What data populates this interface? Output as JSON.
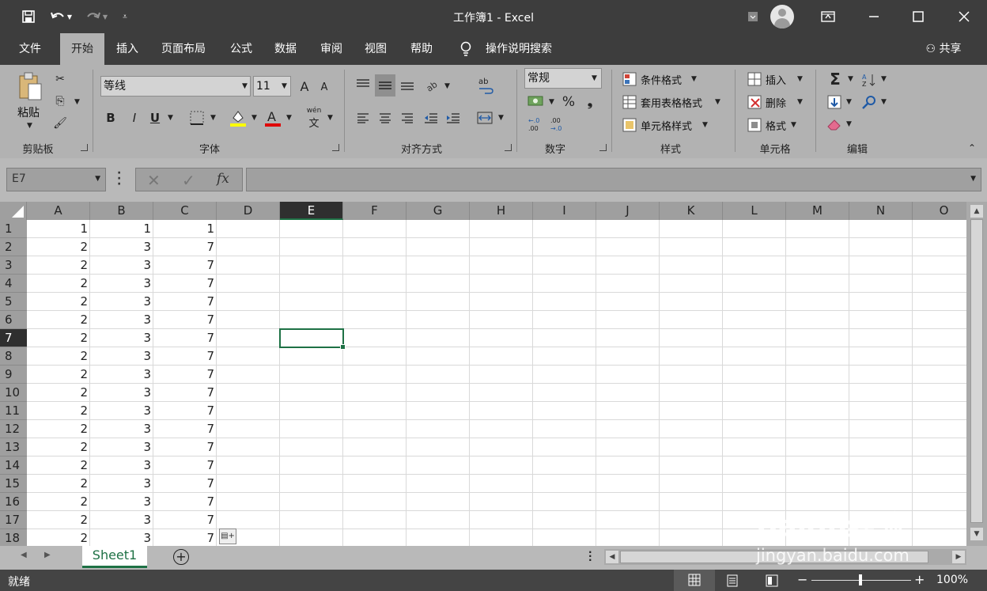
{
  "titlebar": {
    "title": "工作簿1  -  Excel",
    "save_icon": "save-icon",
    "undo_icon": "undo-icon",
    "redo_icon": "redo-icon"
  },
  "menu": {
    "tabs": [
      "文件",
      "开始",
      "插入",
      "页面布局",
      "公式",
      "数据",
      "审阅",
      "视图",
      "帮助"
    ],
    "active_tab": "开始",
    "tell_me": "操作说明搜索",
    "share": "共享"
  },
  "ribbon": {
    "clipboard": {
      "paste": "粘贴",
      "label": "剪贴板"
    },
    "font": {
      "name": "等线",
      "size": "11",
      "bold": "B",
      "italic": "I",
      "underline": "U",
      "label": "字体",
      "grow": "A",
      "shrink": "A",
      "phonetic": "wén"
    },
    "alignment": {
      "label": "对齐方式"
    },
    "number": {
      "format": "常规",
      "percent": "%",
      "comma": "❟",
      "label": "数字"
    },
    "styles": {
      "conditional": "条件格式",
      "table": "套用表格格式",
      "cell_styles": "单元格样式",
      "label": "样式"
    },
    "cells": {
      "insert": "插入",
      "delete": "删除",
      "format": "格式",
      "label": "单元格"
    },
    "editing": {
      "sum": "Σ",
      "label": "编辑"
    }
  },
  "formula_bar": {
    "name_box": "E7",
    "fx": "fx",
    "value": ""
  },
  "grid": {
    "columns": [
      "A",
      "B",
      "C",
      "D",
      "E",
      "F",
      "G",
      "H",
      "I",
      "J",
      "K",
      "L",
      "M",
      "N",
      "O"
    ],
    "selected_column": "E",
    "selected_row": 7,
    "rows": [
      [
        "1",
        "1",
        "1"
      ],
      [
        "2",
        "3",
        "7"
      ],
      [
        "2",
        "3",
        "7"
      ],
      [
        "2",
        "3",
        "7"
      ],
      [
        "2",
        "3",
        "7"
      ],
      [
        "2",
        "3",
        "7"
      ],
      [
        "2",
        "3",
        "7"
      ],
      [
        "2",
        "3",
        "7"
      ],
      [
        "2",
        "3",
        "7"
      ],
      [
        "2",
        "3",
        "7"
      ],
      [
        "2",
        "3",
        "7"
      ],
      [
        "2",
        "3",
        "7"
      ],
      [
        "2",
        "3",
        "7"
      ],
      [
        "2",
        "3",
        "7"
      ],
      [
        "2",
        "3",
        "7"
      ],
      [
        "2",
        "3",
        "7"
      ],
      [
        "2",
        "3",
        "7"
      ],
      [
        "2",
        "3",
        "7"
      ]
    ]
  },
  "sheets": {
    "active": "Sheet1"
  },
  "status": {
    "mode": "就绪",
    "zoom": "100%"
  },
  "watermark": {
    "brand": "Baidu经验",
    "url": "jingyan.baidu.com"
  },
  "colors": {
    "accent": "#1e7145",
    "titlebar": "#3d3d3d",
    "ribbon": "#b2b2b2"
  }
}
